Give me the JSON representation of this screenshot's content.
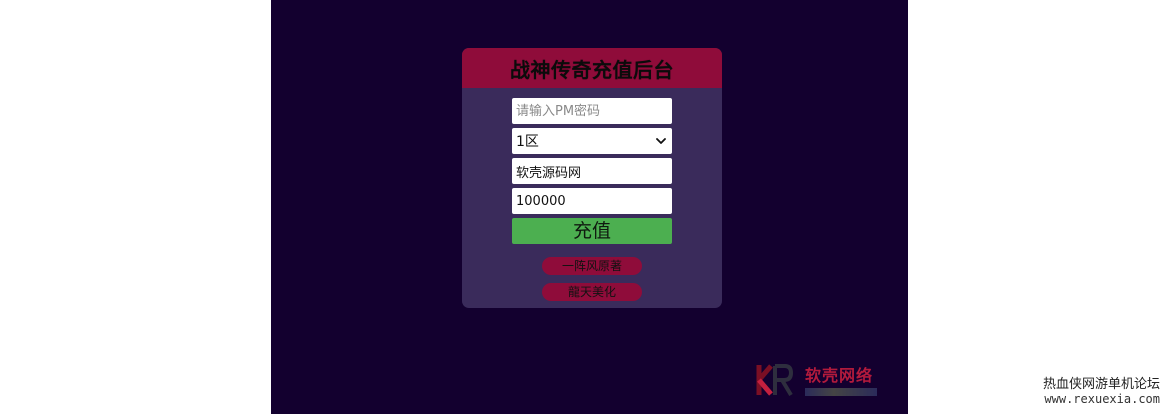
{
  "panel": {
    "title": "战神传奇充值后台",
    "password_placeholder": "请输入PM密码",
    "server_selected": "1区",
    "account_value": "软壳源码网",
    "amount_value": "100000",
    "submit_label": "充值",
    "links": [
      {
        "label": "一阵风原著"
      },
      {
        "label": "龍天美化"
      }
    ]
  },
  "watermark": {
    "brand_text": "软壳网络",
    "logo_letters": "KR",
    "forum_name": "热血侠网游单机论坛",
    "forum_url": "www.rexuexia.com"
  },
  "colors": {
    "background_outer": "#ffffff",
    "stage": "#13002f",
    "panel": "#3a2b5b",
    "header": "#8f0c3a",
    "submit": "#4caf50",
    "pill": "#8f0c3a"
  },
  "icons": {
    "select_arrow": "chevron-down-icon",
    "watermark_logo": "kr-logo-icon"
  }
}
